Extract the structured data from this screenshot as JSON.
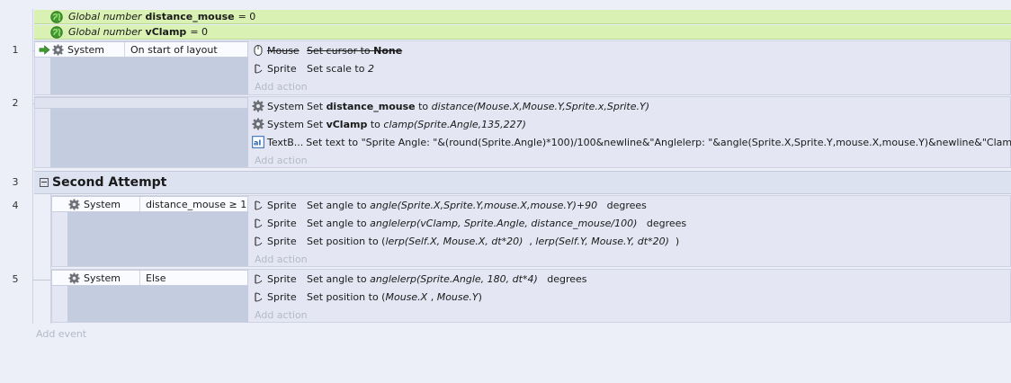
{
  "globals": [
    {
      "keyword": "Global number",
      "name": "distance_mouse",
      "value": "= 0"
    },
    {
      "keyword": "Global number",
      "name": "vClamp",
      "value": "= 0"
    }
  ],
  "events": [
    {
      "num": "1",
      "cond_object": "System",
      "cond_text": "On start of layout",
      "actions": [
        {
          "object": "Mouse",
          "p1": "Set cursor to ",
          "bold": "None",
          "strike": true
        },
        {
          "object": "Sprite",
          "p1": "Set scale to ",
          "italic": "2"
        }
      ],
      "add_action": "Add action"
    },
    {
      "num": "2",
      "actions": [
        {
          "object": "System",
          "p1": "Set ",
          "bold": "distance_mouse",
          "p2": " to ",
          "italic": "distance(Mouse.X,Mouse.Y,Sprite.x,Sprite.Y)"
        },
        {
          "object": "System",
          "p1": "Set ",
          "bold": "vClamp",
          "p2": " to ",
          "italic": "clamp(Sprite.Angle,135,227)"
        },
        {
          "object": "TextB...",
          "p1": "Set text to \"Sprite Angle: \"&(round(Sprite.Angle)*100)/100&newline&\"Anglelerp: \"&angle(Sprite.X,Sprite.Y,mouse.X,mouse.Y)&newline&\"Clamp: \"&vClamp"
        }
      ],
      "add_action": "Add action"
    },
    {
      "num": "3",
      "group_title": "Second Attempt"
    },
    {
      "num": "4",
      "cond_object": "System",
      "cond_text": "distance_mouse ≥ 1",
      "actions": [
        {
          "object": "Sprite",
          "p1": "Set angle to ",
          "italic": "angle(Sprite.X,Sprite.Y,mouse.X,mouse.Y)+90",
          "p2": "   degrees"
        },
        {
          "object": "Sprite",
          "p1": "Set angle to ",
          "italic": "anglelerp(vClamp, Sprite.Angle, distance_mouse/100)",
          "p2": "   degrees"
        },
        {
          "object": "Sprite",
          "p1": "Set position to (",
          "italic": "lerp(Self.X, Mouse.X, dt*20)",
          "p2": "  , ",
          "italic2": "lerp(Self.Y, Mouse.Y, dt*20)",
          "p3": "  )"
        }
      ],
      "add_action": "Add action"
    },
    {
      "num": "5",
      "cond_object": "System",
      "cond_text": "Else",
      "actions": [
        {
          "object": "Sprite",
          "p1": "Set angle to ",
          "italic": "anglelerp(Sprite.Angle, 180, dt*4)",
          "p2": "   degrees"
        },
        {
          "object": "Sprite",
          "p1": "Set position to (",
          "italic": "Mouse.X",
          "p2": " , ",
          "italic2": "Mouse.Y",
          "p3": ")"
        }
      ],
      "add_action": "Add action"
    }
  ],
  "add_event": "Add event",
  "icons": {
    "globe": "globe-icon",
    "gear": "gear-icon",
    "sprite": "sprite-icon",
    "mouse": "mouse-icon",
    "textbox": "textbox-icon",
    "arrow": "start-arrow-icon"
  },
  "colors": {
    "global_bg": "#d9f2b4",
    "group_bg": "#dde2f0",
    "cond_bg": "#c4cde0"
  }
}
